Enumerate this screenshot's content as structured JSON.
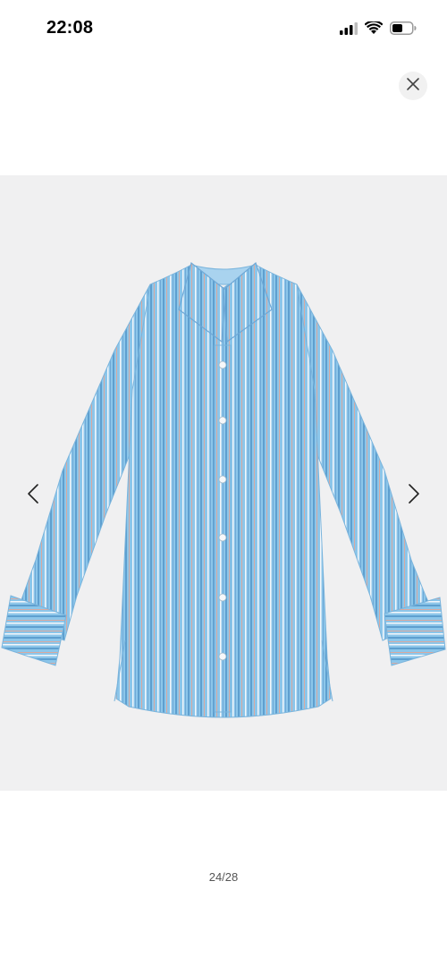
{
  "status_bar": {
    "time": "22:08",
    "icons": [
      "signal-icon",
      "wifi-icon",
      "battery-icon"
    ]
  },
  "viewer": {
    "close_icon": "close-icon",
    "prev_icon": "chevron-left-icon",
    "next_icon": "chevron-right-icon",
    "counter": "24/28",
    "image_subject": "striped-shirt",
    "colors": {
      "shirt": "#8cc6ea",
      "stripe": "#5e9fcf",
      "background": "#f0f0f1"
    }
  }
}
